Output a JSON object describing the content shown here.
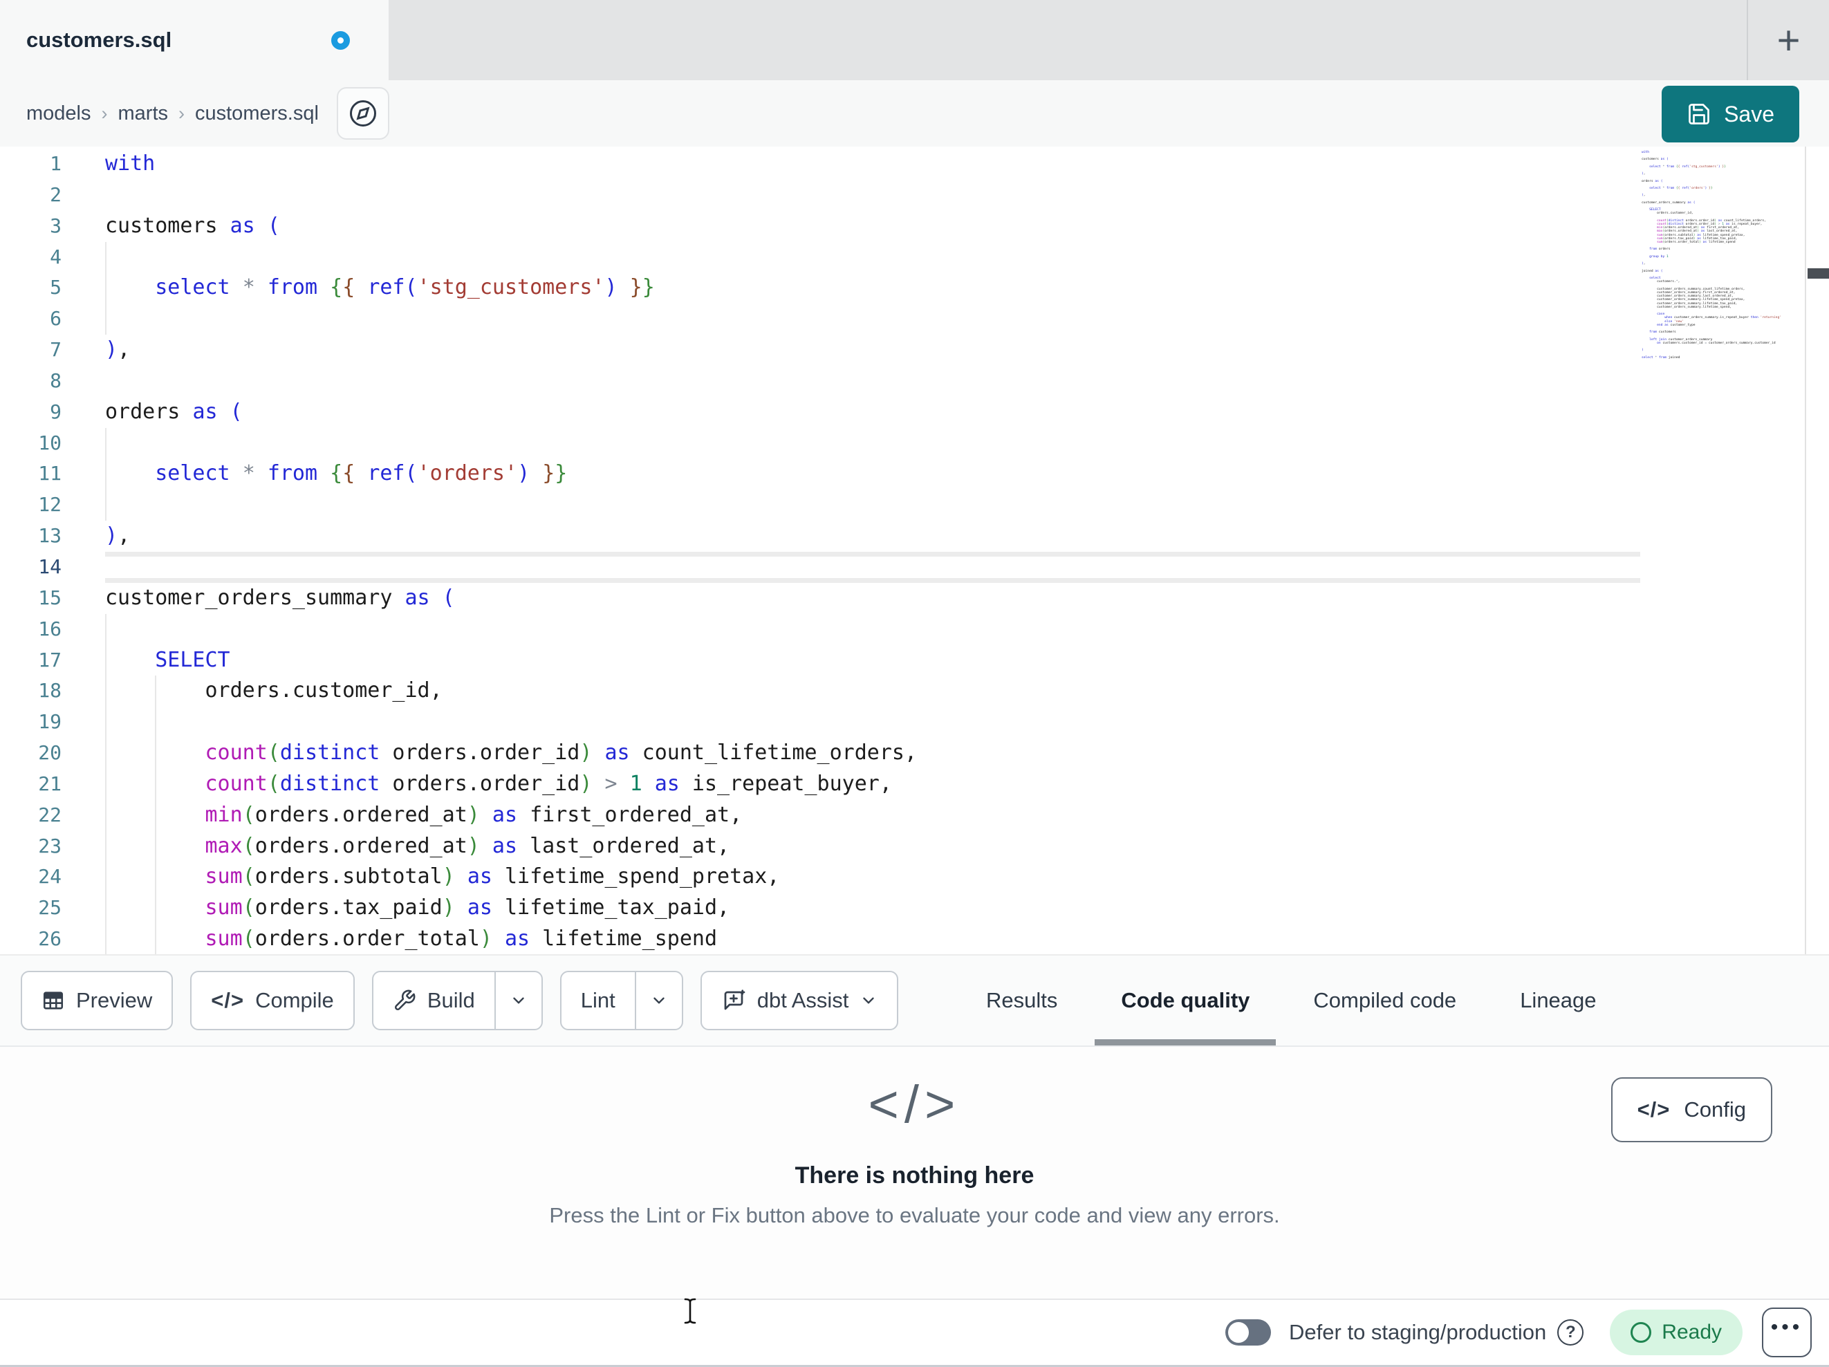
{
  "tab_bar": {
    "tab_title": "customers.sql",
    "unsaved": true,
    "new_tab_label": "+"
  },
  "breadcrumb": {
    "items": [
      "models",
      "marts",
      "customers.sql"
    ],
    "separator": "›"
  },
  "save_button": {
    "label": "Save"
  },
  "toolbar": {
    "preview": "Preview",
    "compile": "Compile",
    "build": "Build",
    "lint": "Lint",
    "dbt_assist": "dbt Assist",
    "compile_glyph": "</>"
  },
  "panel_tabs": {
    "results": "Results",
    "code_quality": "Code quality",
    "compiled_code": "Compiled code",
    "lineage": "Lineage",
    "active": "Code quality"
  },
  "empty_state": {
    "icon_glyph": "</>",
    "title": "There is nothing here",
    "subtitle": "Press the Lint or Fix button above to evaluate your code and view any errors."
  },
  "config_button": {
    "glyph": "</>",
    "label": "Config"
  },
  "status_bar": {
    "defer_label": "Defer to staging/production",
    "help_glyph": "?",
    "ready_label": "Ready",
    "more_glyph": "•••"
  },
  "colors": {
    "accent_teal": "#0e767e",
    "unsaved_dot": "#1b9be0",
    "ready_bg": "#d7f5e2",
    "ready_fg": "#1b7a4b",
    "active_tab_underline": "#8f959b",
    "syntax": {
      "k": "#2328d6",
      "f": "#b01bb5",
      "s": "#a33c34",
      "num": "#0e8161",
      "o": "#7d8590",
      "p1": "#2328d6",
      "p2": "#3a8a3a",
      "p3": "#8a4b2a",
      "d": "#1c1c1c"
    }
  },
  "editor": {
    "current_line": 14,
    "visible_lines": 26,
    "lines": [
      {
        "n": 1,
        "g": [],
        "t": [
          [
            "k",
            "with"
          ]
        ]
      },
      {
        "n": 2,
        "g": [],
        "t": []
      },
      {
        "n": 3,
        "g": [],
        "t": [
          "customers ",
          [
            "k",
            "as"
          ],
          " ",
          [
            "p1",
            "("
          ]
        ]
      },
      {
        "n": 4,
        "g": [
          0
        ],
        "t": []
      },
      {
        "n": 5,
        "g": [
          0
        ],
        "t": [
          "    ",
          [
            "k",
            "select"
          ],
          " ",
          [
            "o",
            "*"
          ],
          " ",
          [
            "k",
            "from"
          ],
          " ",
          [
            "p2",
            "{"
          ],
          [
            "p3",
            "{"
          ],
          " ",
          [
            "k",
            "ref"
          ],
          [
            "p1",
            "("
          ],
          [
            "s",
            "'stg_customers'"
          ],
          [
            "p1",
            ")"
          ],
          " ",
          [
            "p3",
            "}"
          ],
          [
            "p2",
            "}"
          ]
        ]
      },
      {
        "n": 6,
        "g": [
          0
        ],
        "t": []
      },
      {
        "n": 7,
        "g": [],
        "t": [
          [
            "p1",
            ")"
          ],
          ","
        ]
      },
      {
        "n": 8,
        "g": [],
        "t": []
      },
      {
        "n": 9,
        "g": [],
        "t": [
          "orders ",
          [
            "k",
            "as"
          ],
          " ",
          [
            "p1",
            "("
          ]
        ]
      },
      {
        "n": 10,
        "g": [
          0
        ],
        "t": []
      },
      {
        "n": 11,
        "g": [
          0
        ],
        "t": [
          "    ",
          [
            "k",
            "select"
          ],
          " ",
          [
            "o",
            "*"
          ],
          " ",
          [
            "k",
            "from"
          ],
          " ",
          [
            "p2",
            "{"
          ],
          [
            "p3",
            "{"
          ],
          " ",
          [
            "k",
            "ref"
          ],
          [
            "p1",
            "("
          ],
          [
            "s",
            "'orders'"
          ],
          [
            "p1",
            ")"
          ],
          " ",
          [
            "p3",
            "}"
          ],
          [
            "p2",
            "}"
          ]
        ]
      },
      {
        "n": 12,
        "g": [
          0
        ],
        "t": []
      },
      {
        "n": 13,
        "g": [],
        "t": [
          [
            "p1",
            ")"
          ],
          ","
        ]
      },
      {
        "n": 14,
        "g": [],
        "t": []
      },
      {
        "n": 15,
        "g": [],
        "t": [
          "customer_orders_summary ",
          [
            "k",
            "as"
          ],
          " ",
          [
            "p1",
            "("
          ]
        ]
      },
      {
        "n": 16,
        "g": [
          0
        ],
        "t": []
      },
      {
        "n": 17,
        "g": [
          0
        ],
        "t": [
          "    ",
          [
            "k",
            "SELECT"
          ]
        ]
      },
      {
        "n": 18,
        "g": [
          0,
          4
        ],
        "t": [
          "        orders.customer_id,"
        ]
      },
      {
        "n": 19,
        "g": [
          0,
          4
        ],
        "t": []
      },
      {
        "n": 20,
        "g": [
          0,
          4
        ],
        "t": [
          "        ",
          [
            "f",
            "count"
          ],
          [
            "p2",
            "("
          ],
          [
            "k",
            "distinct"
          ],
          " orders.order_id",
          [
            "p2",
            ")"
          ],
          " ",
          [
            "k",
            "as"
          ],
          " count_lifetime_orders,"
        ]
      },
      {
        "n": 21,
        "g": [
          0,
          4
        ],
        "t": [
          "        ",
          [
            "f",
            "count"
          ],
          [
            "p2",
            "("
          ],
          [
            "k",
            "distinct"
          ],
          " orders.order_id",
          [
            "p2",
            ")"
          ],
          " ",
          [
            "o",
            ">"
          ],
          " ",
          [
            "num",
            "1"
          ],
          " ",
          [
            "k",
            "as"
          ],
          " is_repeat_buyer,"
        ]
      },
      {
        "n": 22,
        "g": [
          0,
          4
        ],
        "t": [
          "        ",
          [
            "f",
            "min"
          ],
          [
            "p2",
            "("
          ],
          "orders.ordered_at",
          [
            "p2",
            ")"
          ],
          " ",
          [
            "k",
            "as"
          ],
          " first_ordered_at,"
        ]
      },
      {
        "n": 23,
        "g": [
          0,
          4
        ],
        "t": [
          "        ",
          [
            "f",
            "max"
          ],
          [
            "p2",
            "("
          ],
          "orders.ordered_at",
          [
            "p2",
            ")"
          ],
          " ",
          [
            "k",
            "as"
          ],
          " last_ordered_at,"
        ]
      },
      {
        "n": 24,
        "g": [
          0,
          4
        ],
        "t": [
          "        ",
          [
            "f",
            "sum"
          ],
          [
            "p2",
            "("
          ],
          "orders.subtotal",
          [
            "p2",
            ")"
          ],
          " ",
          [
            "k",
            "as"
          ],
          " lifetime_spend_pretax,"
        ]
      },
      {
        "n": 25,
        "g": [
          0,
          4
        ],
        "t": [
          "        ",
          [
            "f",
            "sum"
          ],
          [
            "p2",
            "("
          ],
          "orders.tax_paid",
          [
            "p2",
            ")"
          ],
          " ",
          [
            "k",
            "as"
          ],
          " lifetime_tax_paid,"
        ]
      },
      {
        "n": 26,
        "g": [
          0,
          4
        ],
        "t": [
          "        ",
          [
            "f",
            "sum"
          ],
          [
            "p2",
            "("
          ],
          "orders.order_total",
          [
            "p2",
            ")"
          ],
          " ",
          [
            "k",
            "as"
          ],
          " lifetime_spend"
        ]
      },
      {
        "n": 27,
        "g": [],
        "t": []
      },
      {
        "n": 28,
        "g": [],
        "t": [
          "    ",
          [
            "k",
            "from"
          ],
          " orders"
        ]
      },
      {
        "n": 29,
        "g": [],
        "t": []
      },
      {
        "n": 30,
        "g": [],
        "t": [
          "    ",
          [
            "k",
            "group"
          ],
          " ",
          [
            "k",
            "by"
          ],
          " ",
          [
            "num",
            "1"
          ]
        ]
      },
      {
        "n": 31,
        "g": [],
        "t": []
      },
      {
        "n": 32,
        "g": [],
        "t": [
          [
            "p1",
            ")"
          ],
          ","
        ]
      },
      {
        "n": 33,
        "g": [],
        "t": []
      },
      {
        "n": 34,
        "g": [],
        "t": [
          "joined ",
          [
            "k",
            "as"
          ],
          " ",
          [
            "p1",
            "("
          ]
        ]
      },
      {
        "n": 35,
        "g": [],
        "t": []
      },
      {
        "n": 36,
        "g": [],
        "t": [
          "    ",
          [
            "k",
            "select"
          ]
        ]
      },
      {
        "n": 37,
        "g": [],
        "t": [
          "        customers.",
          [
            "o",
            "*"
          ],
          ","
        ]
      },
      {
        "n": 38,
        "g": [],
        "t": []
      },
      {
        "n": 39,
        "g": [],
        "t": [
          "        customer_orders_summary.count_lifetime_orders,"
        ]
      },
      {
        "n": 40,
        "g": [],
        "t": [
          "        customer_orders_summary.first_ordered_at,"
        ]
      },
      {
        "n": 41,
        "g": [],
        "t": [
          "        customer_orders_summary.last_ordered_at,"
        ]
      },
      {
        "n": 42,
        "g": [],
        "t": [
          "        customer_orders_summary.lifetime_spend_pretax,"
        ]
      },
      {
        "n": 43,
        "g": [],
        "t": [
          "        customer_orders_summary.lifetime_tax_paid,"
        ]
      },
      {
        "n": 44,
        "g": [],
        "t": [
          "        customer_orders_summary.lifetime_spend,"
        ]
      },
      {
        "n": 45,
        "g": [],
        "t": []
      },
      {
        "n": 46,
        "g": [],
        "t": [
          "        ",
          [
            "k",
            "case"
          ]
        ]
      },
      {
        "n": 47,
        "g": [],
        "t": [
          "            ",
          [
            "k",
            "when"
          ],
          " customer_orders_summary.is_repeat_buyer ",
          [
            "k",
            "then"
          ],
          " ",
          [
            "s",
            "'returning'"
          ]
        ]
      },
      {
        "n": 48,
        "g": [],
        "t": [
          "            ",
          [
            "k",
            "else"
          ],
          " ",
          [
            "s",
            "'new'"
          ]
        ]
      },
      {
        "n": 49,
        "g": [],
        "t": [
          "        ",
          [
            "k",
            "end"
          ],
          " ",
          [
            "k",
            "as"
          ],
          " customer_type"
        ]
      },
      {
        "n": 50,
        "g": [],
        "t": []
      },
      {
        "n": 51,
        "g": [],
        "t": [
          "    ",
          [
            "k",
            "from"
          ],
          " customers"
        ]
      },
      {
        "n": 52,
        "g": [],
        "t": []
      },
      {
        "n": 53,
        "g": [],
        "t": [
          "    ",
          [
            "k",
            "left"
          ],
          " ",
          [
            "k",
            "join"
          ],
          " customer_orders_summary"
        ]
      },
      {
        "n": 54,
        "g": [],
        "t": [
          "        ",
          [
            "k",
            "on"
          ],
          " customers.customer_id ",
          [
            "o",
            "="
          ],
          " customer_orders_summary.customer_id"
        ]
      },
      {
        "n": 55,
        "g": [],
        "t": []
      },
      {
        "n": 56,
        "g": [],
        "t": [
          [
            "p1",
            ")"
          ]
        ]
      },
      {
        "n": 57,
        "g": [],
        "t": []
      },
      {
        "n": 58,
        "g": [],
        "t": [
          [
            "k",
            "select"
          ],
          " ",
          [
            "o",
            "*"
          ],
          " ",
          [
            "k",
            "from"
          ],
          " joined"
        ]
      }
    ]
  }
}
